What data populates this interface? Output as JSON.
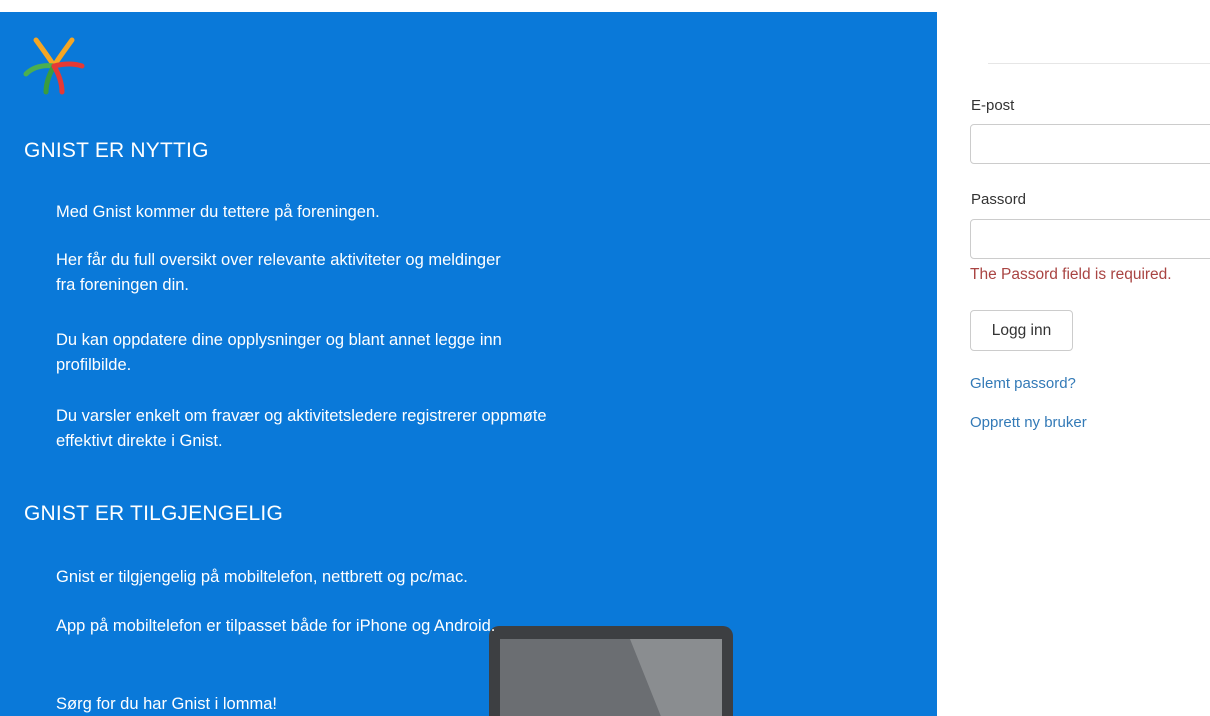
{
  "intro": {
    "section1": {
      "title": "GNIST ER NYTTIG",
      "paragraphs": [
        "Med Gnist kommer du tettere på foreningen.",
        "Her får du full oversikt over relevante aktiviteter og meldinger fra foreningen din.",
        "Du kan oppdatere dine opplysninger og blant annet legge inn profilbilde.",
        "Du varsler enkelt om fravær og aktivitetsledere registrerer oppmøte effektivt direkte i Gnist."
      ]
    },
    "section2": {
      "title": "GNIST ER TILGJENGELIG",
      "paragraphs": [
        "Gnist er tilgjengelig på mobiltelefon, nettbrett og pc/mac.",
        "App på mobiltelefon er tilpasset både for iPhone og Android.",
        "Sørg for du har Gnist i lomma!"
      ]
    },
    "logo_icon": "gnist-star-logo",
    "device_icon": "tablet-device"
  },
  "login": {
    "email_label": "E-post",
    "email_value": "",
    "password_label": "Passord",
    "password_value": "",
    "password_error": "The Passord field is required.",
    "submit_label": "Logg inn",
    "forgot_link": "Glemt passord?",
    "register_link": "Opprett ny bruker"
  },
  "colors": {
    "panel_background": "#0a79d9",
    "error": "#a94442",
    "link": "#337ab7"
  }
}
